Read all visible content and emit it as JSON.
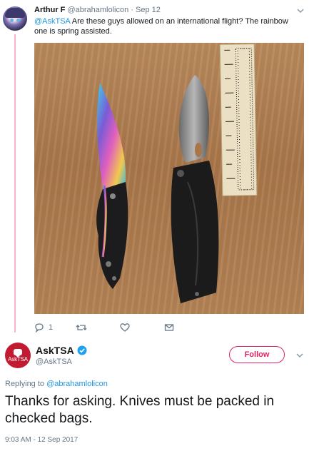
{
  "original_tweet": {
    "display_name": "Arthur F",
    "handle": "@abrahamlolicon",
    "separator": "·",
    "date": "Sep 12",
    "mention": "@AskTSA",
    "text": " Are these guys allowed on an international flight? The rainbow one is spring assisted.",
    "reply_count": "1",
    "retweet_count": "",
    "like_count": ""
  },
  "reply_tweet": {
    "display_name": "AskTSA",
    "handle": "@AskTSA",
    "avatar_label": "AskTSA",
    "follow_label": "Follow",
    "replying_prefix": "Replying to ",
    "replying_handle": "@abrahamlolicon",
    "text": "Thanks for asking. Knives must be packed in checked bags.",
    "timestamp": "9:03 AM - 12 Sep 2017"
  },
  "colors": {
    "link": "#1b95e0",
    "follow": "#e0245e",
    "verified": "#1da1f2",
    "brand_avatar": "#c21b31",
    "thread_line": "#f7b7c6"
  }
}
